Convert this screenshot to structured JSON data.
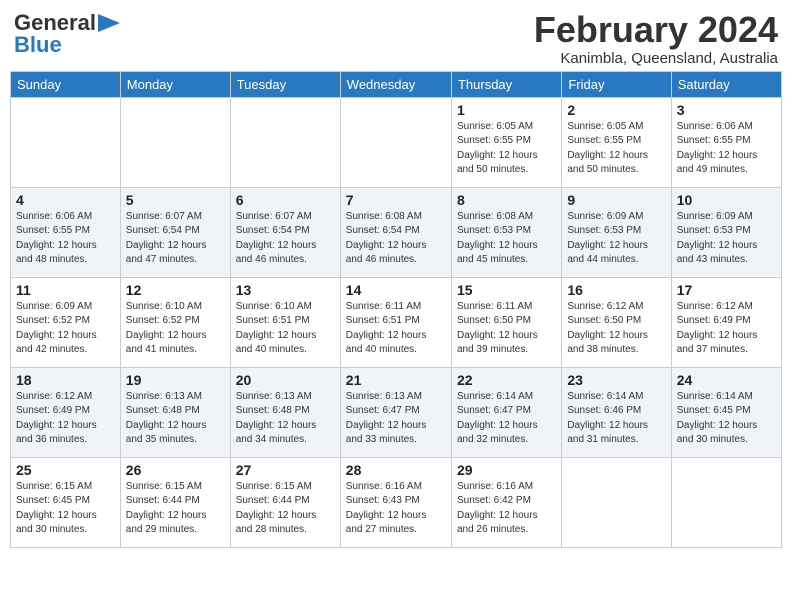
{
  "header": {
    "logo_line1": "General",
    "logo_line2": "Blue",
    "month_title": "February 2024",
    "location": "Kanimbla, Queensland, Australia"
  },
  "days_of_week": [
    "Sunday",
    "Monday",
    "Tuesday",
    "Wednesday",
    "Thursday",
    "Friday",
    "Saturday"
  ],
  "weeks": [
    [
      {
        "day": "",
        "info": ""
      },
      {
        "day": "",
        "info": ""
      },
      {
        "day": "",
        "info": ""
      },
      {
        "day": "",
        "info": ""
      },
      {
        "day": "1",
        "info": "Sunrise: 6:05 AM\nSunset: 6:55 PM\nDaylight: 12 hours\nand 50 minutes."
      },
      {
        "day": "2",
        "info": "Sunrise: 6:05 AM\nSunset: 6:55 PM\nDaylight: 12 hours\nand 50 minutes."
      },
      {
        "day": "3",
        "info": "Sunrise: 6:06 AM\nSunset: 6:55 PM\nDaylight: 12 hours\nand 49 minutes."
      }
    ],
    [
      {
        "day": "4",
        "info": "Sunrise: 6:06 AM\nSunset: 6:55 PM\nDaylight: 12 hours\nand 48 minutes."
      },
      {
        "day": "5",
        "info": "Sunrise: 6:07 AM\nSunset: 6:54 PM\nDaylight: 12 hours\nand 47 minutes."
      },
      {
        "day": "6",
        "info": "Sunrise: 6:07 AM\nSunset: 6:54 PM\nDaylight: 12 hours\nand 46 minutes."
      },
      {
        "day": "7",
        "info": "Sunrise: 6:08 AM\nSunset: 6:54 PM\nDaylight: 12 hours\nand 46 minutes."
      },
      {
        "day": "8",
        "info": "Sunrise: 6:08 AM\nSunset: 6:53 PM\nDaylight: 12 hours\nand 45 minutes."
      },
      {
        "day": "9",
        "info": "Sunrise: 6:09 AM\nSunset: 6:53 PM\nDaylight: 12 hours\nand 44 minutes."
      },
      {
        "day": "10",
        "info": "Sunrise: 6:09 AM\nSunset: 6:53 PM\nDaylight: 12 hours\nand 43 minutes."
      }
    ],
    [
      {
        "day": "11",
        "info": "Sunrise: 6:09 AM\nSunset: 6:52 PM\nDaylight: 12 hours\nand 42 minutes."
      },
      {
        "day": "12",
        "info": "Sunrise: 6:10 AM\nSunset: 6:52 PM\nDaylight: 12 hours\nand 41 minutes."
      },
      {
        "day": "13",
        "info": "Sunrise: 6:10 AM\nSunset: 6:51 PM\nDaylight: 12 hours\nand 40 minutes."
      },
      {
        "day": "14",
        "info": "Sunrise: 6:11 AM\nSunset: 6:51 PM\nDaylight: 12 hours\nand 40 minutes."
      },
      {
        "day": "15",
        "info": "Sunrise: 6:11 AM\nSunset: 6:50 PM\nDaylight: 12 hours\nand 39 minutes."
      },
      {
        "day": "16",
        "info": "Sunrise: 6:12 AM\nSunset: 6:50 PM\nDaylight: 12 hours\nand 38 minutes."
      },
      {
        "day": "17",
        "info": "Sunrise: 6:12 AM\nSunset: 6:49 PM\nDaylight: 12 hours\nand 37 minutes."
      }
    ],
    [
      {
        "day": "18",
        "info": "Sunrise: 6:12 AM\nSunset: 6:49 PM\nDaylight: 12 hours\nand 36 minutes."
      },
      {
        "day": "19",
        "info": "Sunrise: 6:13 AM\nSunset: 6:48 PM\nDaylight: 12 hours\nand 35 minutes."
      },
      {
        "day": "20",
        "info": "Sunrise: 6:13 AM\nSunset: 6:48 PM\nDaylight: 12 hours\nand 34 minutes."
      },
      {
        "day": "21",
        "info": "Sunrise: 6:13 AM\nSunset: 6:47 PM\nDaylight: 12 hours\nand 33 minutes."
      },
      {
        "day": "22",
        "info": "Sunrise: 6:14 AM\nSunset: 6:47 PM\nDaylight: 12 hours\nand 32 minutes."
      },
      {
        "day": "23",
        "info": "Sunrise: 6:14 AM\nSunset: 6:46 PM\nDaylight: 12 hours\nand 31 minutes."
      },
      {
        "day": "24",
        "info": "Sunrise: 6:14 AM\nSunset: 6:45 PM\nDaylight: 12 hours\nand 30 minutes."
      }
    ],
    [
      {
        "day": "25",
        "info": "Sunrise: 6:15 AM\nSunset: 6:45 PM\nDaylight: 12 hours\nand 30 minutes."
      },
      {
        "day": "26",
        "info": "Sunrise: 6:15 AM\nSunset: 6:44 PM\nDaylight: 12 hours\nand 29 minutes."
      },
      {
        "day": "27",
        "info": "Sunrise: 6:15 AM\nSunset: 6:44 PM\nDaylight: 12 hours\nand 28 minutes."
      },
      {
        "day": "28",
        "info": "Sunrise: 6:16 AM\nSunset: 6:43 PM\nDaylight: 12 hours\nand 27 minutes."
      },
      {
        "day": "29",
        "info": "Sunrise: 6:16 AM\nSunset: 6:42 PM\nDaylight: 12 hours\nand 26 minutes."
      },
      {
        "day": "",
        "info": ""
      },
      {
        "day": "",
        "info": ""
      }
    ]
  ]
}
